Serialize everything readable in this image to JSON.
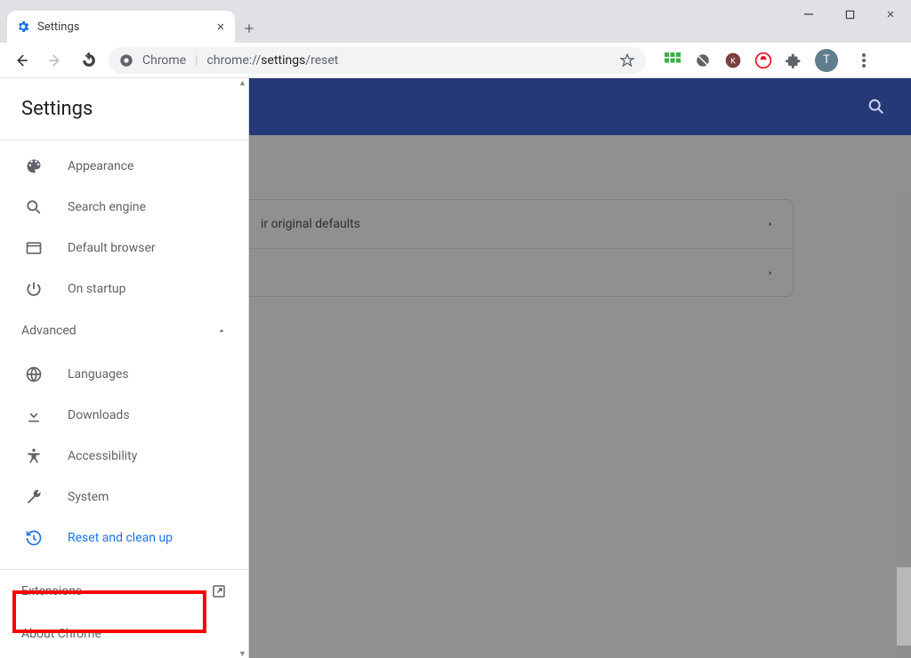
{
  "window": {
    "tab_title": "Settings",
    "win_minimize": "minimize",
    "win_maximize": "maximize",
    "win_close": "close"
  },
  "toolbar": {
    "chrome_label": "Chrome",
    "url_prefix": "chrome://",
    "url_mid": "settings",
    "url_suffix": "/reset",
    "avatar_initial": "T"
  },
  "sidebar": {
    "title": "Settings",
    "items": [
      {
        "label": "Appearance",
        "icon": "palette-icon"
      },
      {
        "label": "Search engine",
        "icon": "search-icon"
      },
      {
        "label": "Default browser",
        "icon": "browser-icon"
      },
      {
        "label": "On startup",
        "icon": "power-icon"
      }
    ],
    "advanced_label": "Advanced",
    "advanced_items": [
      {
        "label": "Languages",
        "icon": "globe-icon"
      },
      {
        "label": "Downloads",
        "icon": "download-icon"
      },
      {
        "label": "Accessibility",
        "icon": "accessibility-icon"
      },
      {
        "label": "System",
        "icon": "wrench-icon"
      },
      {
        "label": "Reset and clean up",
        "icon": "restore-icon",
        "active": true
      }
    ],
    "footer": {
      "extensions": "Extensions",
      "about": "About Chrome"
    }
  },
  "content": {
    "card_rows": [
      {
        "label": "ir original defaults"
      },
      {
        "label": ""
      }
    ]
  }
}
